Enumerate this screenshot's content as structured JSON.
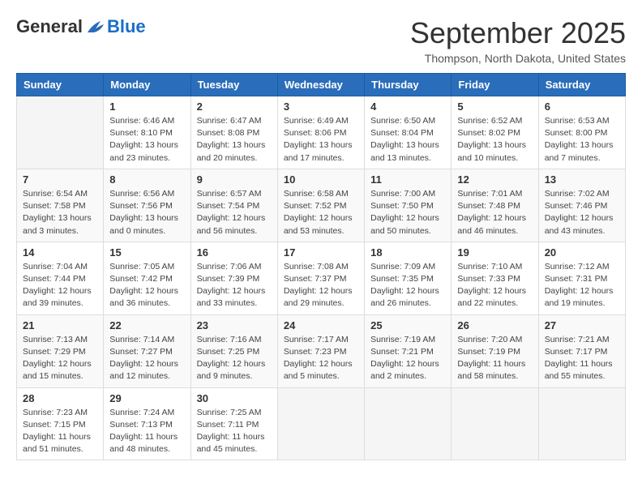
{
  "header": {
    "logo": {
      "general": "General",
      "blue": "Blue"
    },
    "title": "September 2025",
    "location": "Thompson, North Dakota, United States"
  },
  "weekdays": [
    "Sunday",
    "Monday",
    "Tuesday",
    "Wednesday",
    "Thursday",
    "Friday",
    "Saturday"
  ],
  "weeks": [
    [
      {
        "day": "",
        "info": ""
      },
      {
        "day": "1",
        "info": "Sunrise: 6:46 AM\nSunset: 8:10 PM\nDaylight: 13 hours\nand 23 minutes."
      },
      {
        "day": "2",
        "info": "Sunrise: 6:47 AM\nSunset: 8:08 PM\nDaylight: 13 hours\nand 20 minutes."
      },
      {
        "day": "3",
        "info": "Sunrise: 6:49 AM\nSunset: 8:06 PM\nDaylight: 13 hours\nand 17 minutes."
      },
      {
        "day": "4",
        "info": "Sunrise: 6:50 AM\nSunset: 8:04 PM\nDaylight: 13 hours\nand 13 minutes."
      },
      {
        "day": "5",
        "info": "Sunrise: 6:52 AM\nSunset: 8:02 PM\nDaylight: 13 hours\nand 10 minutes."
      },
      {
        "day": "6",
        "info": "Sunrise: 6:53 AM\nSunset: 8:00 PM\nDaylight: 13 hours\nand 7 minutes."
      }
    ],
    [
      {
        "day": "7",
        "info": "Sunrise: 6:54 AM\nSunset: 7:58 PM\nDaylight: 13 hours\nand 3 minutes."
      },
      {
        "day": "8",
        "info": "Sunrise: 6:56 AM\nSunset: 7:56 PM\nDaylight: 13 hours\nand 0 minutes."
      },
      {
        "day": "9",
        "info": "Sunrise: 6:57 AM\nSunset: 7:54 PM\nDaylight: 12 hours\nand 56 minutes."
      },
      {
        "day": "10",
        "info": "Sunrise: 6:58 AM\nSunset: 7:52 PM\nDaylight: 12 hours\nand 53 minutes."
      },
      {
        "day": "11",
        "info": "Sunrise: 7:00 AM\nSunset: 7:50 PM\nDaylight: 12 hours\nand 50 minutes."
      },
      {
        "day": "12",
        "info": "Sunrise: 7:01 AM\nSunset: 7:48 PM\nDaylight: 12 hours\nand 46 minutes."
      },
      {
        "day": "13",
        "info": "Sunrise: 7:02 AM\nSunset: 7:46 PM\nDaylight: 12 hours\nand 43 minutes."
      }
    ],
    [
      {
        "day": "14",
        "info": "Sunrise: 7:04 AM\nSunset: 7:44 PM\nDaylight: 12 hours\nand 39 minutes."
      },
      {
        "day": "15",
        "info": "Sunrise: 7:05 AM\nSunset: 7:42 PM\nDaylight: 12 hours\nand 36 minutes."
      },
      {
        "day": "16",
        "info": "Sunrise: 7:06 AM\nSunset: 7:39 PM\nDaylight: 12 hours\nand 33 minutes."
      },
      {
        "day": "17",
        "info": "Sunrise: 7:08 AM\nSunset: 7:37 PM\nDaylight: 12 hours\nand 29 minutes."
      },
      {
        "day": "18",
        "info": "Sunrise: 7:09 AM\nSunset: 7:35 PM\nDaylight: 12 hours\nand 26 minutes."
      },
      {
        "day": "19",
        "info": "Sunrise: 7:10 AM\nSunset: 7:33 PM\nDaylight: 12 hours\nand 22 minutes."
      },
      {
        "day": "20",
        "info": "Sunrise: 7:12 AM\nSunset: 7:31 PM\nDaylight: 12 hours\nand 19 minutes."
      }
    ],
    [
      {
        "day": "21",
        "info": "Sunrise: 7:13 AM\nSunset: 7:29 PM\nDaylight: 12 hours\nand 15 minutes."
      },
      {
        "day": "22",
        "info": "Sunrise: 7:14 AM\nSunset: 7:27 PM\nDaylight: 12 hours\nand 12 minutes."
      },
      {
        "day": "23",
        "info": "Sunrise: 7:16 AM\nSunset: 7:25 PM\nDaylight: 12 hours\nand 9 minutes."
      },
      {
        "day": "24",
        "info": "Sunrise: 7:17 AM\nSunset: 7:23 PM\nDaylight: 12 hours\nand 5 minutes."
      },
      {
        "day": "25",
        "info": "Sunrise: 7:19 AM\nSunset: 7:21 PM\nDaylight: 12 hours\nand 2 minutes."
      },
      {
        "day": "26",
        "info": "Sunrise: 7:20 AM\nSunset: 7:19 PM\nDaylight: 11 hours\nand 58 minutes."
      },
      {
        "day": "27",
        "info": "Sunrise: 7:21 AM\nSunset: 7:17 PM\nDaylight: 11 hours\nand 55 minutes."
      }
    ],
    [
      {
        "day": "28",
        "info": "Sunrise: 7:23 AM\nSunset: 7:15 PM\nDaylight: 11 hours\nand 51 minutes."
      },
      {
        "day": "29",
        "info": "Sunrise: 7:24 AM\nSunset: 7:13 PM\nDaylight: 11 hours\nand 48 minutes."
      },
      {
        "day": "30",
        "info": "Sunrise: 7:25 AM\nSunset: 7:11 PM\nDaylight: 11 hours\nand 45 minutes."
      },
      {
        "day": "",
        "info": ""
      },
      {
        "day": "",
        "info": ""
      },
      {
        "day": "",
        "info": ""
      },
      {
        "day": "",
        "info": ""
      }
    ]
  ]
}
